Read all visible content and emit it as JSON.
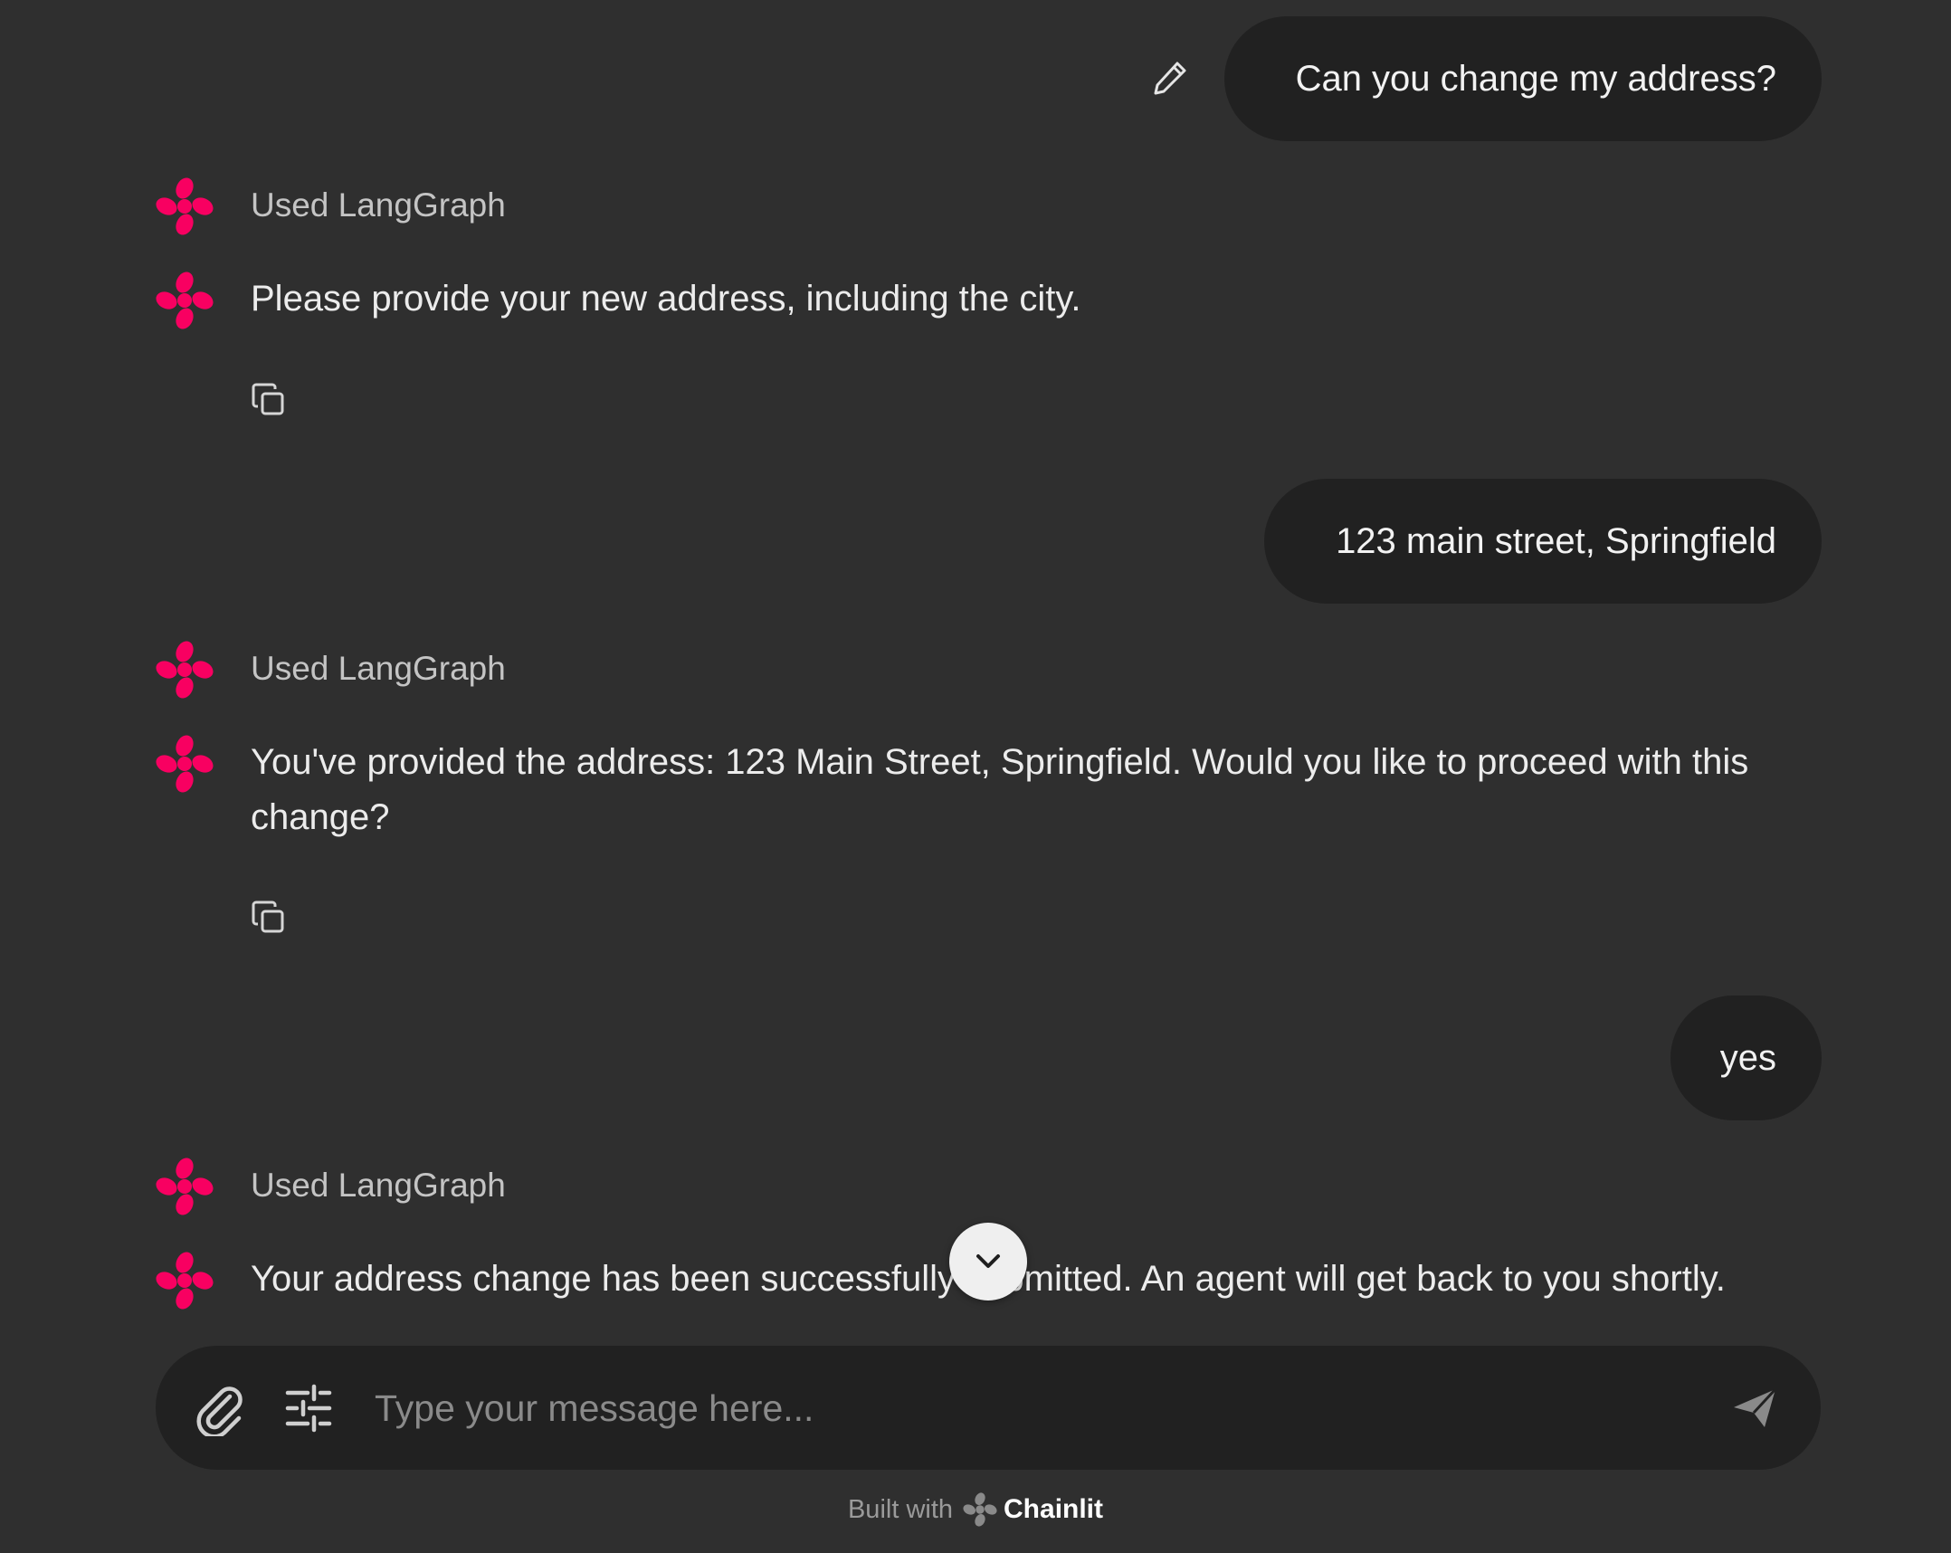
{
  "colors": {
    "background": "#2f2f2f",
    "bubble": "#212121",
    "accent": "#F80061",
    "text": "#ececec",
    "muted": "#c4c4c4"
  },
  "conversation": {
    "user_1": "Can you change my address?",
    "step_1": "Used LangGraph",
    "assistant_1": "Please provide your new address, including the city.",
    "user_2": "123 main street, Springfield",
    "step_2": "Used LangGraph",
    "assistant_2": "You've provided the address: 123 Main Street, Springfield. Would you like to proceed with this change?",
    "user_3": "yes",
    "step_3": "Used LangGraph",
    "assistant_3": "Your address change has been successfully submitted. An agent will get back to you shortly."
  },
  "icons": {
    "edit": "pencil-icon",
    "avatar": "langgraph-avatar-icon",
    "copy": "copy-icon",
    "scroll": "chevron-down-icon",
    "attach": "paperclip-icon",
    "settings": "sliders-icon",
    "send": "send-icon"
  },
  "composer": {
    "placeholder": "Type your message here..."
  },
  "footer": {
    "built_with": "Built with",
    "brand": "Chainlit"
  }
}
